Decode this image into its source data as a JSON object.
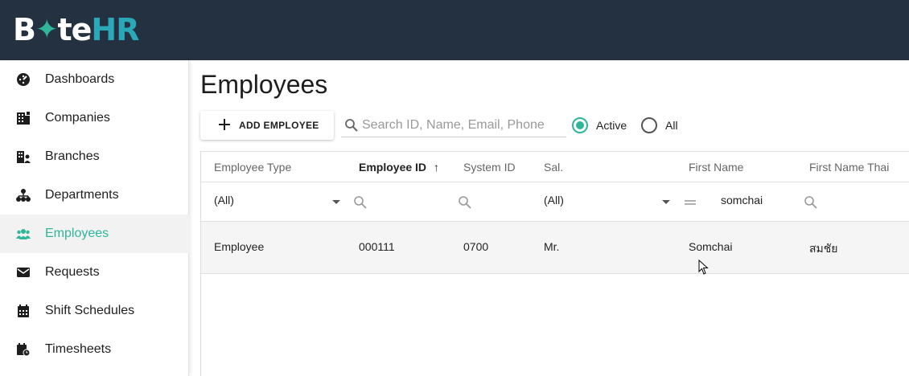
{
  "app": {
    "logo_text": "ByteHR",
    "colors": {
      "header_bg": "#243140",
      "accent": "#2fb59a",
      "logo_hr": "#2aa8b8"
    }
  },
  "sidebar": {
    "items": [
      {
        "label": "Dashboards",
        "icon": "dashboard-gauge-icon",
        "active": false
      },
      {
        "label": "Companies",
        "icon": "building-icon",
        "active": false
      },
      {
        "label": "Branches",
        "icon": "branch-building-person-icon",
        "active": false
      },
      {
        "label": "Departments",
        "icon": "org-chart-icon",
        "active": false
      },
      {
        "label": "Employees",
        "icon": "users-group-icon",
        "active": true
      },
      {
        "label": "Requests",
        "icon": "mail-inbox-icon",
        "active": false
      },
      {
        "label": "Shift Schedules",
        "icon": "calendar-icon",
        "active": false
      },
      {
        "label": "Timesheets",
        "icon": "calendar-clock-icon",
        "active": false
      }
    ]
  },
  "main": {
    "title": "Employees",
    "toolbar": {
      "add_label": "ADD EMPLOYEE",
      "search_placeholder": "Search ID, Name, Email, Phone",
      "search_value": "",
      "status_options": [
        {
          "label": "Active",
          "selected": true
        },
        {
          "label": "All",
          "selected": false
        }
      ]
    },
    "table": {
      "columns": [
        {
          "label": "Employee Type",
          "sorted": false
        },
        {
          "label": "Employee ID",
          "sorted": true,
          "sort_dir": "asc"
        },
        {
          "label": "System ID",
          "sorted": false
        },
        {
          "label": "Sal.",
          "sorted": false
        },
        {
          "label": "First Name",
          "sorted": false
        },
        {
          "label": "First Name Thai",
          "sorted": false
        }
      ],
      "sort_arrow": "↑",
      "filters": {
        "employee_type": "(All)",
        "employee_id": "",
        "system_id": "",
        "salutation": "(All)",
        "first_name_operator": "equals-icon",
        "first_name": "somchai",
        "first_name_thai": ""
      },
      "rows": [
        {
          "employee_type": "Employee",
          "employee_id": "000111",
          "system_id": "0700",
          "salutation": "Mr.",
          "first_name": "Somchai",
          "first_name_thai": "สมชัย"
        }
      ]
    }
  }
}
